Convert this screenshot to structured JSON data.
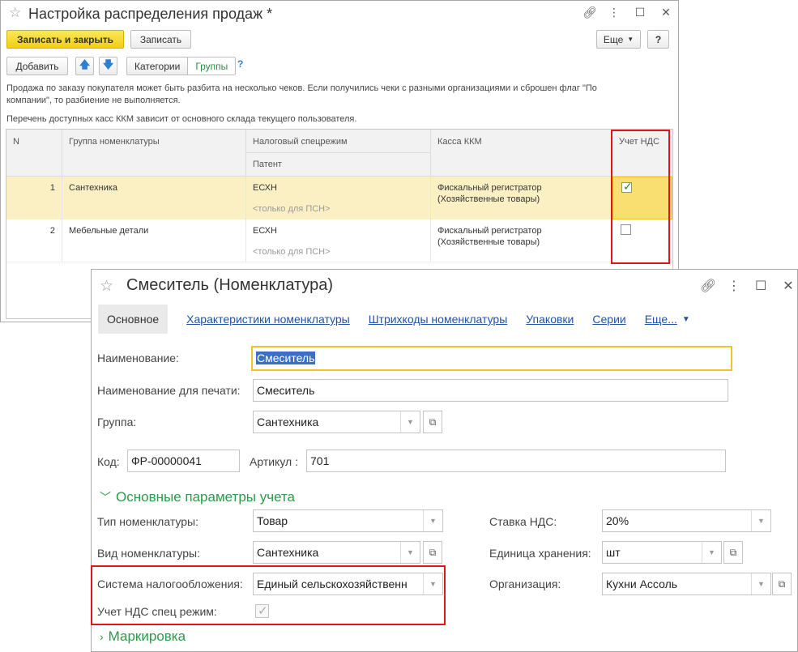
{
  "window1": {
    "title": "Настройка распределения продаж *",
    "toolbar": {
      "save_close": "Записать и закрыть",
      "save": "Записать",
      "more": "Еще",
      "help": "?",
      "add": "Добавить",
      "categories": "Категории",
      "groups": "Группы",
      "hint": "?"
    },
    "info_text_1": "Продажа по заказу покупателя может быть разбита на несколько чеков. Если получились чеки с разными организациями и сброшен флаг \"По",
    "info_text_1b": "компании\", то разбиение не выполняется.",
    "info_text_2": "Перечень доступных касс ККМ зависит от основного склада текущего пользователя.",
    "table": {
      "headers": {
        "n": "N",
        "group": "Группа номенклатуры",
        "tax": "Налоговый спецрежим",
        "patent": "Патент",
        "kkm": "Касса ККМ",
        "vat": "Учет НДС"
      },
      "rows": [
        {
          "n": "1",
          "group": "Сантехника",
          "tax": "ЕСХН",
          "patent": "<только для ПСН>",
          "kkm_1": "Фискальный регистратор",
          "kkm_2": "(Хозяйственные товары)",
          "vat": true
        },
        {
          "n": "2",
          "group": "Мебельные детали",
          "tax": "ЕСХН",
          "patent": "<только для ПСН>",
          "kkm_1": "Фискальный регистратор",
          "kkm_2": "(Хозяйственные товары)",
          "vat": false
        }
      ]
    }
  },
  "window2": {
    "title": "Смеситель (Номенклатура)",
    "tabs": [
      "Основное",
      "Характеристики номенклатуры",
      "Штрихкоды номенклатуры",
      "Упаковки",
      "Серии",
      "Еще..."
    ],
    "fields": {
      "name_label": "Наименование:",
      "name_value": "Смеситель",
      "print_name_label": "Наименование для печати:",
      "print_name_value": "Смеситель",
      "group_label": "Группа:",
      "group_value": "Сантехника",
      "code_label": "Код:",
      "code_value": "ФР-00000041",
      "article_label": "Артикул :",
      "article_value": "701"
    },
    "section_main": "Основные параметры учета",
    "params": {
      "type_label": "Тип номенклатуры:",
      "type_value": "Товар",
      "kind_label": "Вид номенклатуры:",
      "kind_value": "Сантехника",
      "taxsys_label": "Система налогообложения:",
      "taxsys_value": "Единый сельскохозяйственн",
      "vat_special_label": "Учет НДС спец режим:",
      "vat_special_checked": true,
      "vat_rate_label": "Ставка НДС:",
      "vat_rate_value": "20%",
      "unit_label": "Единица хранения:",
      "unit_value": "шт",
      "org_label": "Организация:",
      "org_value": "Кухни Ассоль"
    },
    "section_marking": "Маркировка"
  },
  "icons": [
    "star-icon",
    "link-icon",
    "more-vertical-icon",
    "maximize-icon",
    "close-icon",
    "arrow-up-icon",
    "arrow-down-icon",
    "dropdown-icon",
    "open-icon",
    "checkmark-icon",
    "chevron-down-icon",
    "chevron-right-icon"
  ],
  "colors": {
    "highlight_red": "#e0161b",
    "selected_row": "#fbf0c3",
    "primary_button": "#f2cf14",
    "section_green": "#2b9a49",
    "link_blue": "#2251a4"
  }
}
